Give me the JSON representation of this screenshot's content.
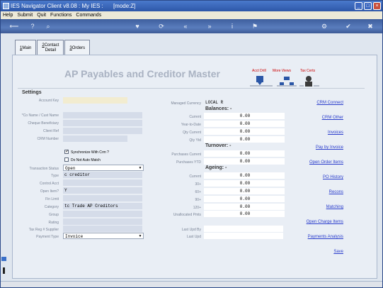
{
  "window": {
    "title": "IES Navigator Client v8.08 : My IES :",
    "mode": "[mode:Z]"
  },
  "menu": [
    "Help",
    "Submit",
    "Quit",
    "Functions",
    "Commands"
  ],
  "tabs": [
    {
      "key": "1",
      "label": "Main"
    },
    {
      "key": "2",
      "label": "Contact",
      "label2": "Detail"
    },
    {
      "key": "3",
      "label": "Orders"
    }
  ],
  "page_title": "AP Payables and Creditor Master",
  "top_actions": [
    "Acct Drill",
    "More Views",
    "Tax Certs"
  ],
  "settings_heading": "Settings",
  "settings": {
    "account_key": {
      "label": "Account Key",
      "value": ""
    },
    "name": {
      "label": "*Co Name / Cust Name",
      "value": ""
    },
    "cheque_beneficiary": {
      "label": "Cheque Beneficiary",
      "value": ""
    },
    "client_ref": {
      "label": "Client Ref",
      "value": ""
    },
    "crm_number": {
      "label": "CRM Number",
      "value": ""
    },
    "sync_crm": {
      "label": "Synchronize With Crm ?",
      "checked": true
    },
    "no_auto_match": {
      "label": "Do Not Auto Match",
      "checked": false
    },
    "transaction_status": {
      "label": "Transaction Status",
      "value": "Open"
    },
    "type": {
      "label": "Type",
      "value": "c creditor"
    },
    "control_acct": {
      "label": "Control Acct",
      "value": ""
    },
    "open_item": {
      "label": "Open Item?",
      "value": "Y"
    },
    "fin_limit": {
      "label": "Fin Limit",
      "value": ""
    },
    "category": {
      "label": "Category",
      "value": "tc Trade AP Creditors"
    },
    "group": {
      "label": "Group",
      "value": ""
    },
    "rating": {
      "label": "Rating",
      "value": ""
    },
    "tax_reg": {
      "label": "Tax Reg # Supplier",
      "value": ""
    },
    "payment_type": {
      "label": "Payment Type",
      "value": "Invoice"
    }
  },
  "managed_currency": {
    "label": "Managed Currency",
    "value": "LOCAL R"
  },
  "balances": {
    "heading": "Balances: -",
    "rows": [
      {
        "label": "Current",
        "value": "0.00"
      },
      {
        "label": "Year-to-Date",
        "value": "0.00"
      },
      {
        "label": "Qty Current",
        "value": "0.00"
      },
      {
        "label": "Qty Ytd",
        "value": "0.00"
      }
    ]
  },
  "turnover": {
    "heading": "Turnover: -",
    "rows": [
      {
        "label": "Purchases Current",
        "value": "0.00"
      },
      {
        "label": "Purchases YTD",
        "value": "0.00"
      }
    ]
  },
  "ageing": {
    "heading": "Ageing: -",
    "rows": [
      {
        "label": "Current",
        "value": "0.00"
      },
      {
        "label": "30+",
        "value": "0.00"
      },
      {
        "label": "60+",
        "value": "0.00"
      },
      {
        "label": "90+",
        "value": "0.00"
      },
      {
        "label": "120+",
        "value": "0.00"
      },
      {
        "label": "Unallocated Pmts",
        "value": "0.00"
      }
    ]
  },
  "last_upd_by": {
    "label": "Last Upd By",
    "value": ""
  },
  "last_upd": {
    "label": "Last Upd",
    "value": ""
  },
  "links": [
    "CRM Connect",
    "CRM Other",
    "Invoices",
    "Pay by Invoice",
    "Open Order Items",
    "PO History",
    "Recons",
    "Matching",
    "Open Charge Items",
    "Payments Analysis",
    "Save"
  ]
}
